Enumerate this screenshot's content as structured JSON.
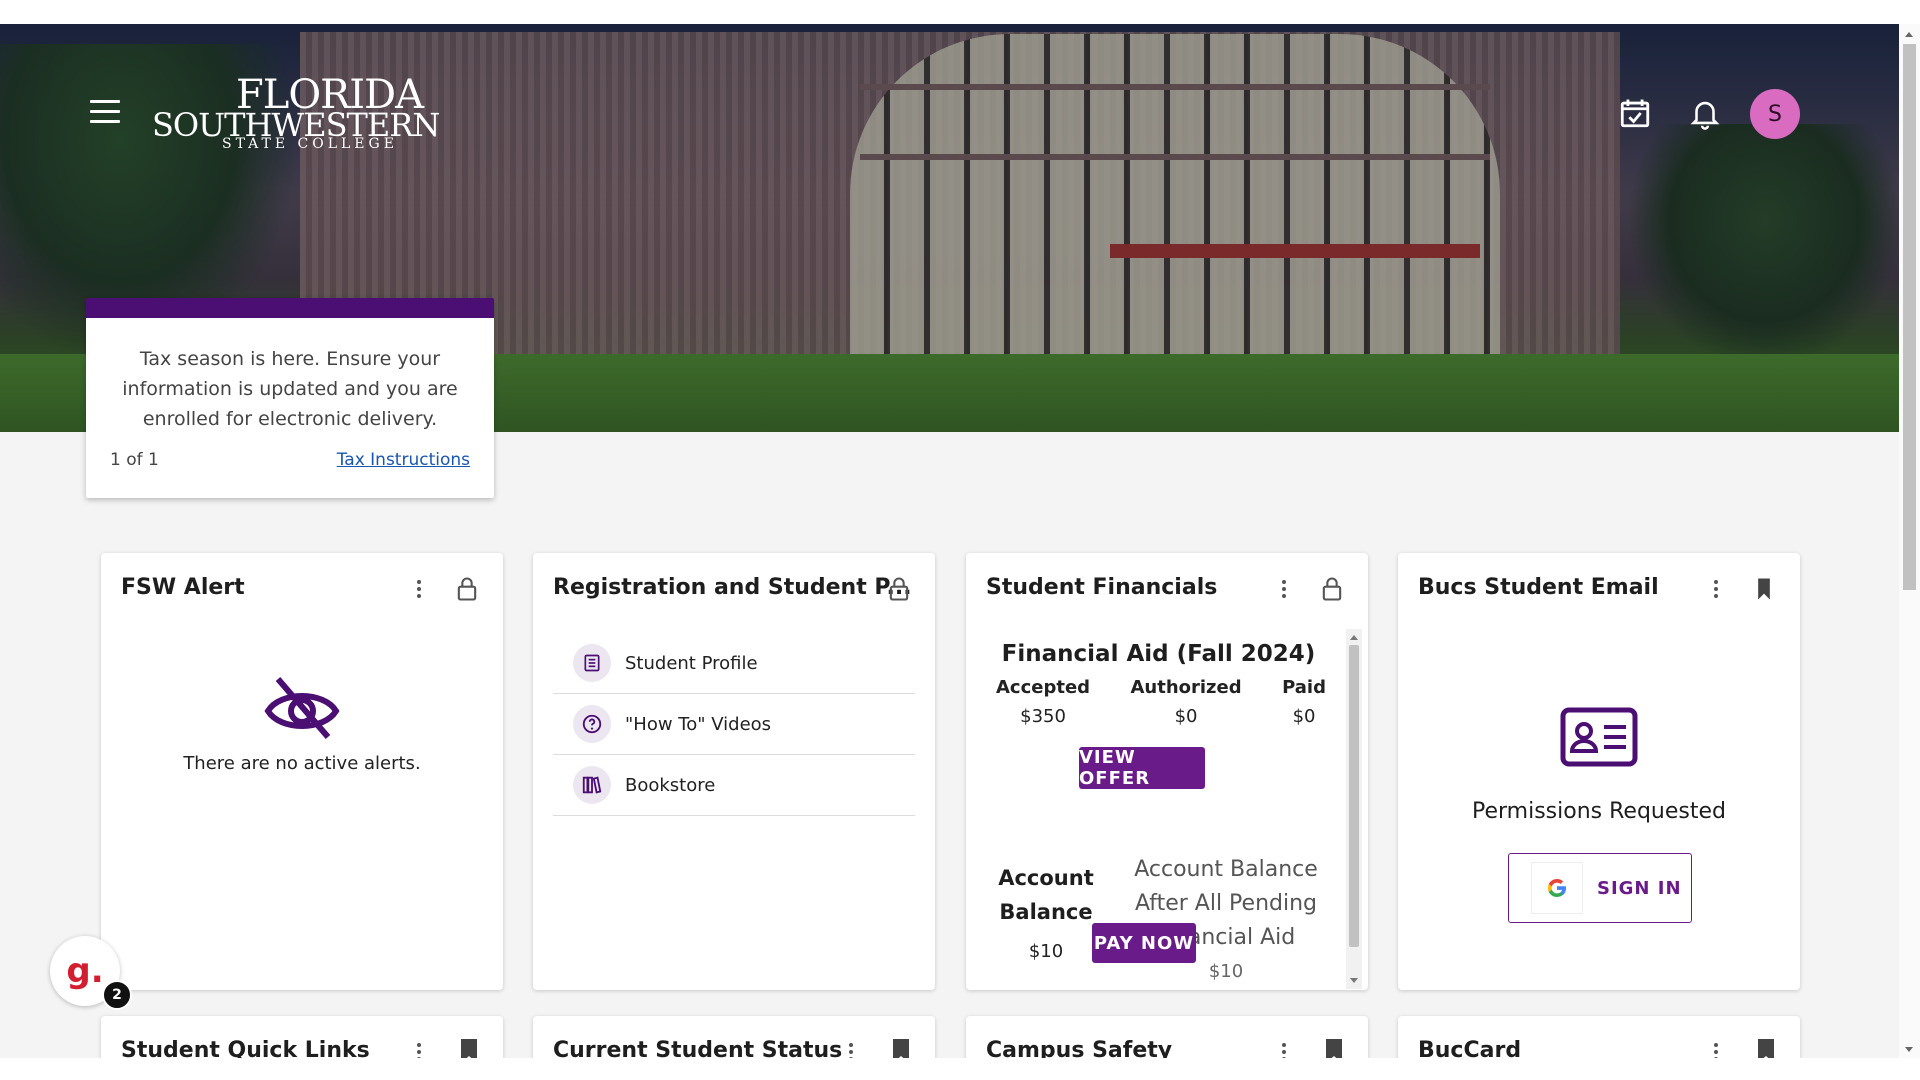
{
  "header": {
    "logo_line1": "FLORIDA",
    "logo_line2": "SOUTHWESTERN",
    "logo_line3": "STATE COLLEGE",
    "avatar_initial": "S",
    "icons": [
      "menu-icon",
      "calendar-check-icon",
      "bell-icon"
    ]
  },
  "notice": {
    "message": "Tax season is here. Ensure your information is updated and you are enrolled for electronic delivery.",
    "counter": "1 of 1",
    "link": "Tax Instructions",
    "accent": "#4b0e73"
  },
  "cards": {
    "fsw_alert": {
      "title": "FSW Alert",
      "empty_text": "There are no active alerts."
    },
    "registration": {
      "title": "Registration and Student P...",
      "links": [
        {
          "label": "Student Profile",
          "icon": "document-icon"
        },
        {
          "label": "\"How To\" Videos",
          "icon": "question-icon"
        },
        {
          "label": "Bookstore",
          "icon": "books-icon"
        }
      ]
    },
    "financials": {
      "title": "Student Financials",
      "aid_heading": "Financial Aid (Fall 2024)",
      "accepted_label": "Accepted",
      "accepted_value": "$350",
      "authorized_label": "Authorized",
      "authorized_value": "$0",
      "paid_label": "Paid",
      "paid_value": "$0",
      "view_offer": "VIEW OFFER",
      "balance_label": "Account Balance",
      "balance_value": "$10",
      "pending_label": "Account Balance After All Pending Financial Aid",
      "pending_value": "$10",
      "pay_now": "PAY NOW"
    },
    "email": {
      "title": "Bucs Student Email",
      "permissions": "Permissions Requested",
      "signin": "SIGN IN"
    }
  },
  "row2": [
    {
      "title": "Student Quick Links"
    },
    {
      "title": "Current Student Status"
    },
    {
      "title": "Campus Safety"
    },
    {
      "title": "BucCard"
    }
  ],
  "grammarly": {
    "letter": "g.",
    "badge": "2"
  },
  "colors": {
    "brand_purple": "#6a1b8a",
    "avatar": "#d96cc1"
  }
}
